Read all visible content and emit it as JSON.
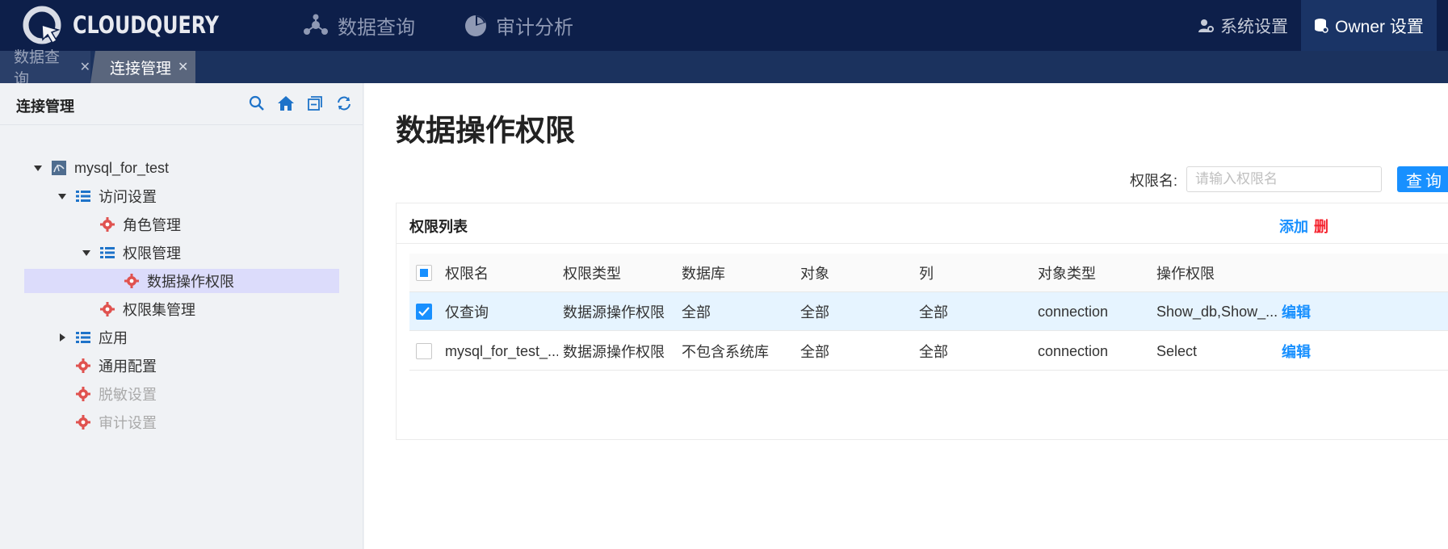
{
  "header": {
    "logo_text": "CLOUDQUERY",
    "nav": [
      {
        "label": "数据查询",
        "icon": "molecule-icon"
      },
      {
        "label": "审计分析",
        "icon": "pie-chart-icon"
      }
    ],
    "system_settings": "系统设置",
    "owner_settings": "Owner 设置",
    "colors": {
      "bg": "#0d1f4a",
      "owner_bg": "#1a3466"
    }
  },
  "tabs": [
    {
      "label": "数据查询",
      "active": false
    },
    {
      "label": "连接管理",
      "active": true
    }
  ],
  "sidebar": {
    "title": "连接管理",
    "tools": [
      "search-icon",
      "home-icon",
      "collapse-icon",
      "refresh-icon"
    ],
    "tree": [
      {
        "label": "mysql_for_test",
        "icon": "database-icon",
        "expanded": true
      },
      {
        "label": "访问设置",
        "icon": "list-icon",
        "expanded": true
      },
      {
        "label": "角色管理",
        "icon": "gear-icon"
      },
      {
        "label": "权限管理",
        "icon": "list-icon",
        "expanded": true
      },
      {
        "label": "数据操作权限",
        "icon": "gear-icon",
        "selected": true
      },
      {
        "label": "权限集管理",
        "icon": "gear-icon"
      },
      {
        "label": "应用",
        "icon": "list-icon",
        "expanded": false
      },
      {
        "label": "通用配置",
        "icon": "gear-icon"
      },
      {
        "label": "脱敏设置",
        "icon": "gear-icon",
        "disabled": true
      },
      {
        "label": "审计设置",
        "icon": "gear-icon",
        "disabled": true
      }
    ]
  },
  "main": {
    "title": "数据操作权限",
    "search": {
      "label": "权限名:",
      "placeholder": "请输入权限名",
      "value": "",
      "button": "查询"
    },
    "card": {
      "title": "权限列表",
      "add": "添加",
      "delete": "删"
    },
    "table": {
      "columns": [
        "权限名",
        "权限类型",
        "数据库",
        "对象",
        "列",
        "对象类型",
        "操作权限"
      ],
      "rows": [
        {
          "checked": true,
          "cells": [
            "仅查询",
            "数据源操作权限",
            "全部",
            "全部",
            "全部",
            "connection",
            "Show_db,Show_..."
          ],
          "action": "编辑"
        },
        {
          "checked": false,
          "cells": [
            "mysql_for_test_...",
            "数据源操作权限",
            "不包含系统库",
            "全部",
            "全部",
            "connection",
            "Select"
          ],
          "action": "编辑"
        }
      ]
    },
    "pager_prev": "<",
    "accent": "#1890ff"
  }
}
